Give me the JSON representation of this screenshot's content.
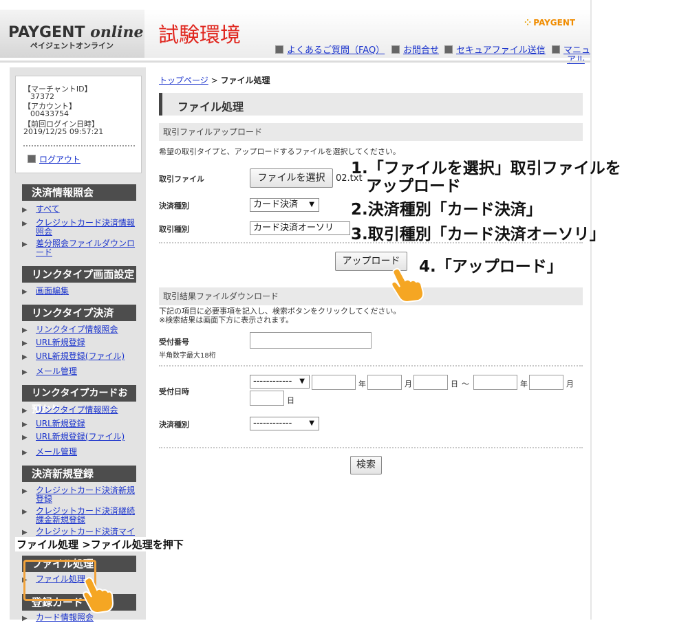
{
  "header": {
    "brand_logo_main": "PAYGENT",
    "brand_logo_italic": "online",
    "brand_sub": "ペイジェントオンライン",
    "env_title": "試験環境",
    "paygent_logo": "PAYGENT",
    "links": [
      "よくあるご質問（FAQ）",
      "お問合せ",
      "セキュアファイル送信",
      "マニュ",
      "アル"
    ]
  },
  "account": {
    "merchant_label": "【マーチャントID】",
    "merchant_id": "37372",
    "account_label": "【アカウント】",
    "account_id": "00433754",
    "last_login_label": "【前回ログイン日時】",
    "last_login": "2019/12/25 09:57:21",
    "logout": "ログアウト"
  },
  "sidebar": {
    "sections": [
      {
        "title": "決済情報照会",
        "items": [
          "すべて",
          "クレジットカード決済情報照会",
          "差分照会ファイルダウンロード"
        ]
      },
      {
        "title": "リンクタイプ画面設定",
        "items": [
          "画面編集"
        ]
      },
      {
        "title": "リンクタイプ決済",
        "items": [
          "リンクタイプ情報照会",
          "URL新規登録",
          "URL新規登録(ファイル)",
          "メール管理"
        ]
      },
      {
        "title": "リンクタイプカードお預かり",
        "items": [
          "リンクタイプ情報照会",
          "URL新規登録",
          "URL新規登録(ファイル)",
          "メール管理"
        ]
      },
      {
        "title": "決済新規登録",
        "items": [
          "クレジットカード決済新規登録",
          "クレジットカード決済継続課金新規登録",
          "クレジットカード決済マイナ"
        ]
      },
      {
        "title": "ファイル処理",
        "items": [
          "ファイル処理"
        ]
      },
      {
        "title": "登録カード",
        "items": [
          "カード情報照会"
        ]
      }
    ]
  },
  "main": {
    "breadcrumb_top": "トップページ",
    "breadcrumb_sep": ">",
    "breadcrumb_current": "ファイル処理",
    "page_title": "ファイル処理",
    "upload": {
      "section_title": "取引ファイルアップロード",
      "desc": "希望の取引タイプと、アップロードするファイルを選択してください。",
      "file_label": "取引ファイル",
      "file_button": "ファイルを選択",
      "file_name": "02.txt",
      "payment_type_label": "決済種別",
      "payment_type_value": "カード決済",
      "trans_type_label": "取引種別",
      "trans_type_value": "カード決済オーソリ",
      "upload_button": "アップロード"
    },
    "download": {
      "section_title": "取引結果ファイルダウンロード",
      "desc1": "下記の項目に必要事項を記入し、検索ボタンをクリックしてください。",
      "desc2": "※検索結果は画面下方に表示されます。",
      "receipt_label": "受付番号",
      "receipt_hint": "半角数字最大18桁",
      "date_label": "受付日時",
      "date_select": "------------",
      "year": "年",
      "month": "月",
      "day": "日",
      "tilde": "～",
      "pay_type_label": "決済種別",
      "pay_type_select": "------------",
      "search_button": "検索"
    }
  },
  "annotations": {
    "step1_line1": "1.「ファイルを選択」取引ファイルを",
    "step1_line2": "アップロード",
    "step2": "2.決済種別「カード決済」",
    "step3": "3.取引種別「カード決済オーソリ」",
    "step4": "4.「アップロード」",
    "sidebar_note": "ファイル処理 >ファイル処理を押下"
  },
  "colors": {
    "env_title": "#e0261e",
    "link": "#1a33cc",
    "nav_header": "#4d4d4d",
    "highlight": "#f0a23b",
    "paygent_logo": "#f08c00"
  }
}
